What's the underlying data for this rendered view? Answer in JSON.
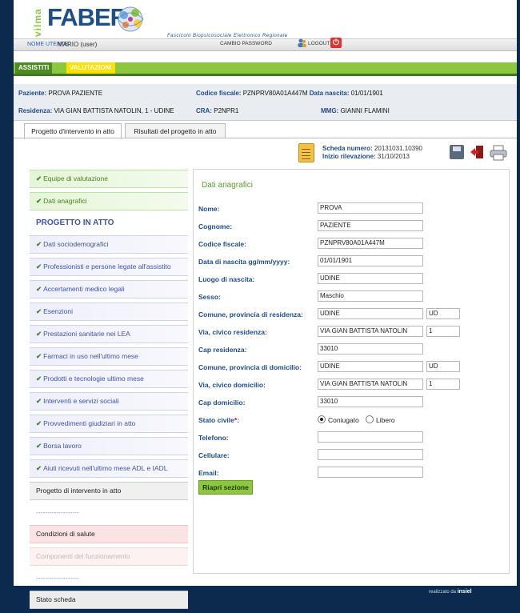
{
  "header": {
    "logo_v": "vilma",
    "logo_text": "FABER",
    "logo_subtitle": "Fascicolo Biopsicosociale Elettronico Regionale",
    "user_label": "NOME UTENTE:",
    "user_name": "MARIO (user)",
    "change_password": "CAMBIO PASSWORD",
    "logout": "LOGOUT"
  },
  "nav": {
    "tabs": [
      "ASSISTITI",
      "VALUTAZIONI"
    ]
  },
  "patient": {
    "paziente_label": "Paziente:",
    "paziente": "PROVA PAZIENTE",
    "cf_label": "Codice fiscale:",
    "cf": "PZNPRV80A01A447M",
    "nascita_label": "Data nascita:",
    "nascita": "01/01/1901",
    "residenza_label": "Residenza:",
    "residenza": "VIA GIAN BATTISTA NATOLIN, 1 - UDINE",
    "cra_label": "CRA:",
    "cra": "P2NPR1",
    "mmg_label": "MMG:",
    "mmg": "GIANNI FLAMINI"
  },
  "subtabs": [
    "Progetto d'intervento in atto",
    "Risultati del progetto in atto"
  ],
  "scheda": {
    "numero_label": "Scheda numero:",
    "numero": "20131031.10390",
    "inizio_label": "Inizio rilevazione:",
    "inizio": "31/10/2013"
  },
  "sidebar": {
    "items": [
      {
        "label": "Equipe di valutazione",
        "style": "green",
        "check": true
      },
      {
        "label": "Dati anagrafici",
        "style": "green",
        "check": true
      },
      {
        "label": "PROGETTO IN ATTO",
        "style": "title",
        "check": false
      },
      {
        "label": "Dati sociodemografici",
        "style": "blue",
        "check": true
      },
      {
        "label": "Professionisti e persone legate all'assistito",
        "style": "blue",
        "check": true
      },
      {
        "label": "Accertamenti medico legali",
        "style": "blue",
        "check": true
      },
      {
        "label": "Esenzioni",
        "style": "blue",
        "check": true
      },
      {
        "label": "Prestazioni sanitarie nei LEA",
        "style": "blue",
        "check": true
      },
      {
        "label": "Farmaci in uso nell'ultimo mese",
        "style": "blue",
        "check": true
      },
      {
        "label": "Prodotti e tecnologie ultimo mese",
        "style": "blue",
        "check": true
      },
      {
        "label": "Interventi e servizi sociali",
        "style": "blue",
        "check": true
      },
      {
        "label": "Provvedimenti giudiziari in atto",
        "style": "blue",
        "check": true
      },
      {
        "label": "Borsa lavoro",
        "style": "blue",
        "check": true
      },
      {
        "label": "Aiuti ricevuti nell'ultimo mese ADL e IADL",
        "style": "blue",
        "check": true
      },
      {
        "label": "Progetto di intervento in atto",
        "style": "plain",
        "check": false
      },
      {
        "label": "-------------------",
        "style": "dots",
        "check": false
      },
      {
        "label": "Condizioni di salute",
        "style": "pink",
        "check": false
      },
      {
        "label": "Componenti del funzionamento",
        "style": "pink-light",
        "check": false
      },
      {
        "label": "-------------------",
        "style": "dots",
        "check": false
      },
      {
        "label": "Stato scheda",
        "style": "stato",
        "check": false
      }
    ]
  },
  "form": {
    "section_title": "Dati anagrafici",
    "nome_label": "Nome:",
    "nome": "PROVA",
    "cognome_label": "Cognome:",
    "cognome": "PAZIENTE",
    "cf_label": "Codice fiscale:",
    "cf": "PZNPRV80A01A447M",
    "nascita_label": "Data di nascita gg/mm/yyyy:",
    "nascita": "01/01/1901",
    "luogo_label": "Luogo di nascita:",
    "luogo": "UDINE",
    "sesso_label": "Sesso:",
    "sesso": "Maschio",
    "com_res_label": "Comune, provincia di residenza:",
    "com_res": "UDINE",
    "prov_res": "UD",
    "via_res_label": "Via, civico residenza:",
    "via_res": "VIA GIAN BATTISTA NATOLIN",
    "civ_res": "1",
    "cap_res_label": "Cap residenza:",
    "cap_res": "33010",
    "com_dom_label": "Comune, provincia di domicilio:",
    "com_dom": "UDINE",
    "prov_dom": "UD",
    "via_dom_label": "Via, civico domicilio:",
    "via_dom": "VIA GIAN BATTISTA NATOLIN",
    "civ_dom": "1",
    "cap_dom_label": "Cap domicilio:",
    "cap_dom": "33010",
    "stato_civile_label": "Stato civile",
    "stato_civile_req": "*",
    "stato_civile_colon": ":",
    "opt_coniugato": "Coniugato",
    "opt_libero": "Libero",
    "telefono_label": "Telefono:",
    "telefono": "",
    "cellulare_label": "Cellulare:",
    "cellulare": "",
    "email_label": "Email:",
    "email": "",
    "riapri": "Riapri sezione"
  },
  "footer": {
    "realizzato": "realizzato da",
    "brand": "insiel"
  },
  "colors": {
    "accent_green": "#8dc63f",
    "brand_blue": "#1d4c87",
    "background": "#0c2a4d"
  }
}
